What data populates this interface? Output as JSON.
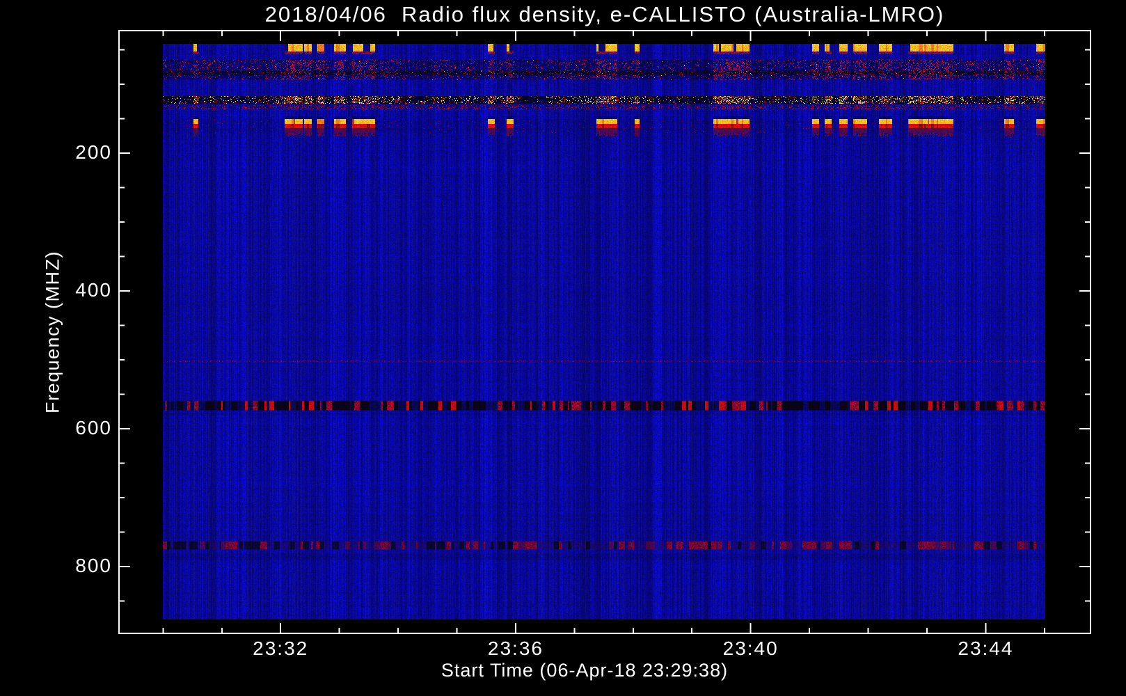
{
  "window": {
    "background": "#000000",
    "text_color": "#ffffff"
  },
  "chart_data": {
    "type": "heatmap",
    "title": "2018/04/06  Radio flux density, e-CALLISTO (Australia-LMRO)",
    "xlabel": "Start Time (06-Apr-18 23:29:38)",
    "ylabel": "Frequency (MHZ)",
    "date": "2018/04/06",
    "instrument": "e-CALLISTO",
    "station": "Australia-LMRO",
    "start_time": "23:29:38",
    "x_axis": {
      "start": "23:29:15",
      "end": "23:45:47",
      "major_ticks": [
        "23:32",
        "23:36",
        "23:40",
        "23:44"
      ],
      "minor_tick_interval_seconds": 60
    },
    "y_axis": {
      "min_mhz": 22,
      "max_mhz": 897,
      "unit": "MHz",
      "direction": "increasing-downward",
      "major_ticks": [
        200,
        400,
        600,
        800
      ],
      "minor_tick_interval_mhz": 50
    },
    "image": {
      "time_start": "23:30:00",
      "time_end": "23:45:01",
      "freq_min_mhz": 41,
      "freq_max_mhz": 877,
      "background": "noisy saturated blue with vertical striations"
    },
    "palette": {
      "base_blue": "#0b0bd2",
      "light_column_blue": "#2c2ce8",
      "dark_column_blue": "#0000a0",
      "bright_yellow": "#f2c82a",
      "bright_orange": "#e87820",
      "bright_red": "#dd1412",
      "dark_red": "#5a1038",
      "near_black": "#000018",
      "frame_white": "#ffffff"
    },
    "bands": [
      {
        "name": "rfi-dash-row",
        "style": "yellow-dash-row",
        "freq_mhz": [
          41,
          52
        ],
        "in_bursts": true
      },
      {
        "name": "rfi-dash-underline",
        "style": "dark-red-underline",
        "freq_mhz": [
          52,
          56
        ],
        "in_bursts": true
      },
      {
        "name": "broadcast-noise-band",
        "style": "noisy-dark-red-specks",
        "freq_mhz": [
          63,
          94
        ]
      },
      {
        "name": "dark-wavy-line",
        "style": "dark-wavy",
        "freq_mhz": [
          79,
          87
        ]
      },
      {
        "name": "bright-speck-line",
        "style": "dark-bright-specks",
        "freq_mhz": [
          117,
          128
        ]
      },
      {
        "name": "red-speckle-row",
        "style": "red-speckle",
        "freq_mhz": [
          129,
          137
        ]
      },
      {
        "name": "bar-top-shadow",
        "style": "bar-top-shadow",
        "freq_mhz": [
          146,
          150
        ],
        "in_bursts": true
      },
      {
        "name": "rfi-bars",
        "style": "rfi-bars",
        "freq_mhz": [
          150,
          170
        ],
        "in_bursts": true
      },
      {
        "name": "bar-bottom-fringe",
        "style": "bar-fringe",
        "freq_mhz": [
          170,
          175
        ],
        "in_bursts": true
      },
      {
        "name": "faint-red-line",
        "style": "faint-red-line",
        "freq_mhz": [
          500,
          504
        ]
      },
      {
        "name": "dark-interference-band",
        "style": "black-red-speckle",
        "freq_mhz": [
          559,
          574
        ]
      },
      {
        "name": "dark-line",
        "style": "slight-dark",
        "freq_mhz": [
          576,
          581
        ]
      },
      {
        "name": "red-interference-band",
        "style": "red-dark-speckle",
        "freq_mhz": [
          763,
          776
        ]
      },
      {
        "name": "lower-dark-rows",
        "style": "slight-dark",
        "freq_mhz": [
          781,
          791
        ]
      }
    ],
    "rfi_bursts": [
      {
        "start": "23:30:31",
        "end": "23:30:36"
      },
      {
        "start": "23:32:04",
        "end": "23:32:23"
      },
      {
        "start": "23:32:24",
        "end": "23:32:32"
      },
      {
        "start": "23:32:38",
        "end": "23:32:45"
      },
      {
        "start": "23:32:55",
        "end": "23:33:07"
      },
      {
        "start": "23:33:13",
        "end": "23:33:37"
      },
      {
        "start": "23:35:32",
        "end": "23:35:39"
      },
      {
        "start": "23:35:51",
        "end": "23:35:58"
      },
      {
        "start": "23:37:23",
        "end": "23:37:44"
      },
      {
        "start": "23:38:02",
        "end": "23:38:07"
      },
      {
        "start": "23:39:22",
        "end": "23:39:59"
      },
      {
        "start": "23:41:03",
        "end": "23:41:10"
      },
      {
        "start": "23:41:16",
        "end": "23:41:23"
      },
      {
        "start": "23:41:31",
        "end": "23:41:39"
      },
      {
        "start": "23:41:45",
        "end": "23:41:59"
      },
      {
        "start": "23:42:11",
        "end": "23:42:25"
      },
      {
        "start": "23:42:41",
        "end": "23:43:27"
      },
      {
        "start": "23:44:19",
        "end": "23:44:29"
      },
      {
        "start": "23:44:52",
        "end": "23:45:01"
      }
    ]
  }
}
